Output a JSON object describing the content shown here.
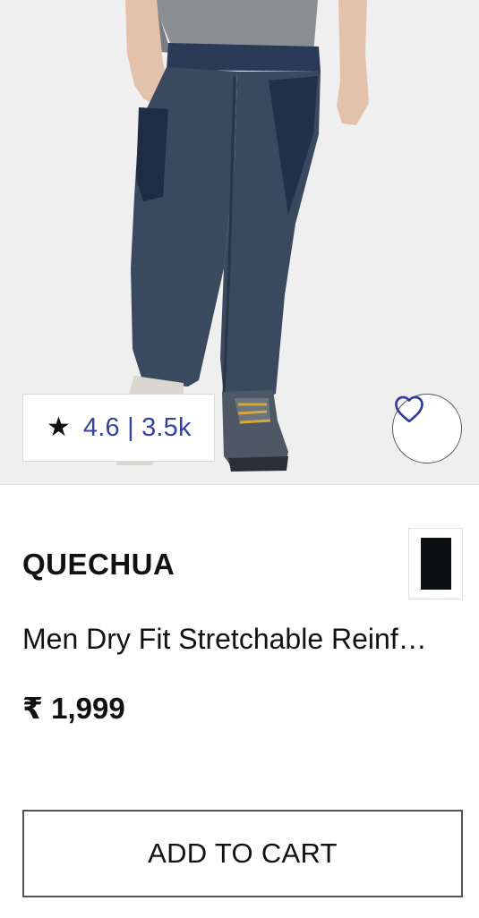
{
  "product": {
    "image_alt": "product-image-dark-blue-trousers",
    "rating": {
      "star_icon": "★",
      "text": "4.6 | 3.5k"
    },
    "wishlist_icon": "heart-outline-icon",
    "brand": "QUECHUA",
    "swatch_color": "#0b1112",
    "name": "Men Dry Fit Stretchable Reinf…",
    "price": "₹ 1,999",
    "add_to_cart_label": "ADD TO CART"
  },
  "colors": {
    "rating_text": "#3043a6",
    "image_background": "#efefef"
  }
}
